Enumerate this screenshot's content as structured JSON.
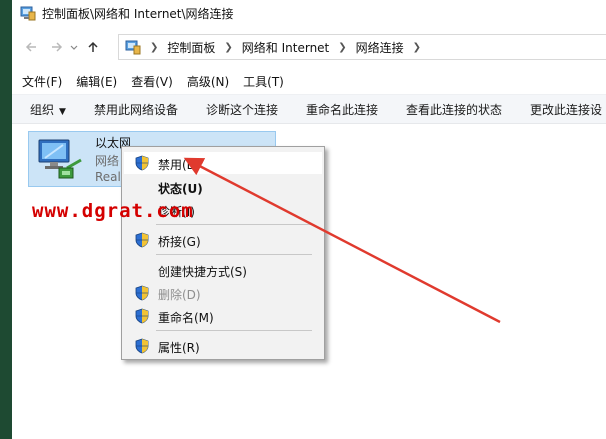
{
  "window": {
    "title": "控制面板\\网络和 Internet\\网络连接"
  },
  "navigation": {
    "back_icon": "arrow-left-icon",
    "forward_icon": "arrow-right-icon",
    "recent_icon": "chevron-down-icon",
    "up_icon": "arrow-up-icon",
    "breadcrumbs": [
      "控制面板",
      "网络和 Internet",
      "网络连接"
    ]
  },
  "menubar": {
    "items": [
      "文件(F)",
      "编辑(E)",
      "查看(V)",
      "高级(N)",
      "工具(T)"
    ]
  },
  "commandbar": {
    "organize": "组织",
    "items": [
      "禁用此网络设备",
      "诊断这个连接",
      "重命名此连接",
      "查看此连接的状态",
      "更改此连接设"
    ]
  },
  "connection": {
    "name": "以太网",
    "status": "网络",
    "device": "Realt",
    "icon": "ethernet-adapter-icon"
  },
  "context_menu": {
    "items": [
      {
        "label": "禁用(B)",
        "shield": true,
        "highlighted": true,
        "bold": false,
        "disabled": false
      },
      {
        "label": "状态(U)",
        "shield": false,
        "highlighted": false,
        "bold": true,
        "disabled": false
      },
      {
        "label": "诊断(I)",
        "shield": false,
        "highlighted": false,
        "bold": false,
        "disabled": false
      },
      {
        "label": "桥接(G)",
        "shield": true,
        "highlighted": false,
        "bold": false,
        "disabled": false
      },
      {
        "label": "创建快捷方式(S)",
        "shield": false,
        "highlighted": false,
        "bold": false,
        "disabled": false
      },
      {
        "label": "删除(D)",
        "shield": true,
        "highlighted": false,
        "bold": false,
        "disabled": true
      },
      {
        "label": "重命名(M)",
        "shield": true,
        "highlighted": false,
        "bold": false,
        "disabled": false
      },
      {
        "label": "属性(R)",
        "shield": true,
        "highlighted": false,
        "bold": false,
        "disabled": false
      }
    ]
  },
  "annotation": {
    "watermark": "www.dgrat.com",
    "arrow_color": "#e03a2e"
  }
}
